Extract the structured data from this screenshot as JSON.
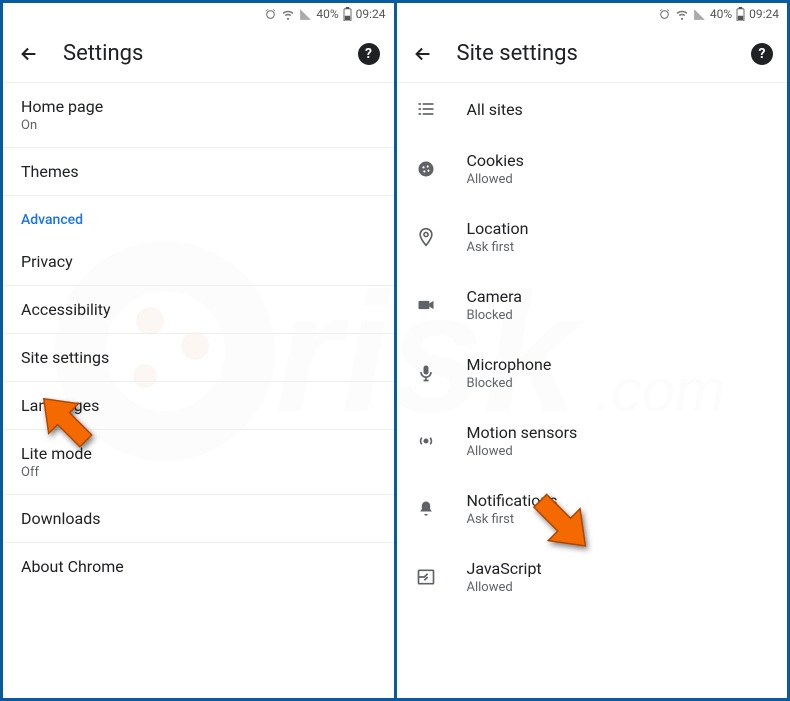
{
  "statusbar": {
    "battery_pct": "40%",
    "time": "09:24"
  },
  "left": {
    "title": "Settings",
    "items": [
      {
        "label": "Home page",
        "sub": "On"
      },
      {
        "label": "Themes",
        "sub": ""
      }
    ],
    "section": "Advanced",
    "advanced_items": [
      {
        "label": "Privacy",
        "sub": ""
      },
      {
        "label": "Accessibility",
        "sub": ""
      },
      {
        "label": "Site settings",
        "sub": ""
      },
      {
        "label": "Languages",
        "sub": ""
      },
      {
        "label": "Lite mode",
        "sub": "Off"
      },
      {
        "label": "Downloads",
        "sub": ""
      },
      {
        "label": "About Chrome",
        "sub": ""
      }
    ]
  },
  "right": {
    "title": "Site settings",
    "items": [
      {
        "icon": "list-icon",
        "label": "All sites",
        "sub": ""
      },
      {
        "icon": "cookie-icon",
        "label": "Cookies",
        "sub": "Allowed"
      },
      {
        "icon": "location-icon",
        "label": "Location",
        "sub": "Ask first"
      },
      {
        "icon": "camera-icon",
        "label": "Camera",
        "sub": "Blocked"
      },
      {
        "icon": "microphone-icon",
        "label": "Microphone",
        "sub": "Blocked"
      },
      {
        "icon": "motion-icon",
        "label": "Motion sensors",
        "sub": "Allowed"
      },
      {
        "icon": "bell-icon",
        "label": "Notifications",
        "sub": "Ask first"
      },
      {
        "icon": "javascript-icon",
        "label": "JavaScript",
        "sub": "Allowed"
      }
    ]
  }
}
